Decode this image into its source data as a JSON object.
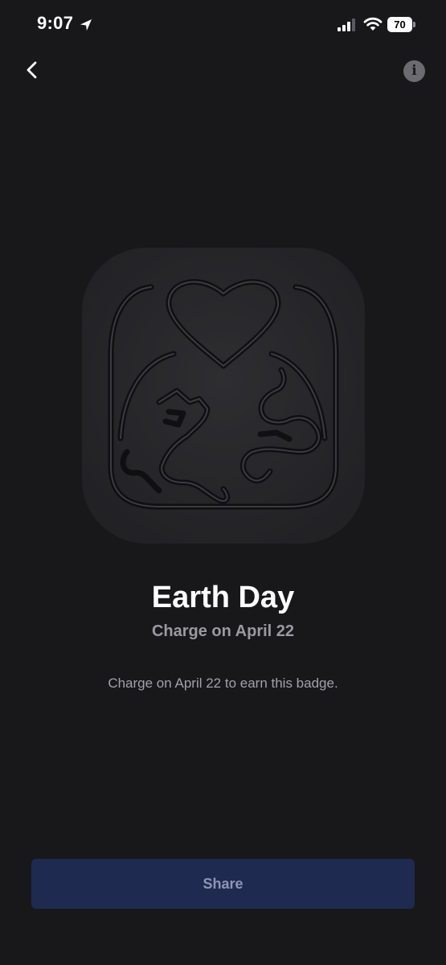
{
  "status_bar": {
    "time": "9:07",
    "battery_level": "70",
    "icons": [
      "location-arrow-icon",
      "cellular-signal-icon",
      "wifi-icon",
      "battery-icon"
    ]
  },
  "nav": {
    "back_icon": "chevron-left-icon",
    "info_icon": "info-icon",
    "info_glyph": "i"
  },
  "badge": {
    "title": "Earth Day",
    "subtitle": "Charge on April 22",
    "description": "Charge on April 22 to earn this badge.",
    "image_icon": "earth-day-badge-icon",
    "state": "locked"
  },
  "actions": {
    "share_label": "Share"
  },
  "colors": {
    "background": "#18181b",
    "badge_tile": "#2a2a2d",
    "share_button": "#1f2a50",
    "share_text": "#8e96b4",
    "subtitle": "#9a9a9f"
  }
}
